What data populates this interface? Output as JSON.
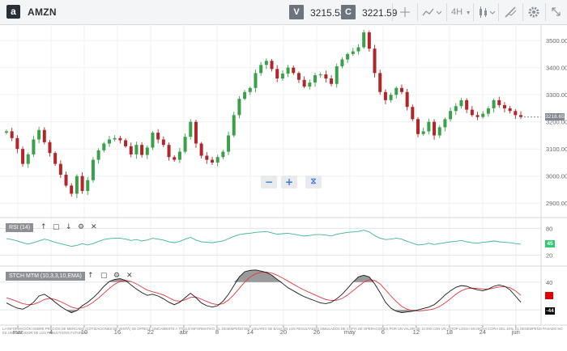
{
  "header": {
    "ticker": "AMZN",
    "logo_letter": "a",
    "sell_label": "V",
    "sell_price": "3215.53",
    "buy_label": "C",
    "buy_price": "3221.59",
    "interval": "4H"
  },
  "icons": [
    "amazon-logo-icon",
    "crosshair-icon",
    "line-chart-icon",
    "candlestick-icon",
    "indicators-icon",
    "settings-icon",
    "fullscreen-icon",
    "zoom-out-icon",
    "zoom-in-icon",
    "share-icon",
    "arrow-up-icon",
    "expand-icon",
    "arrow-down-icon",
    "gear-icon",
    "close-icon"
  ],
  "colors": {
    "bull": "#3aa14a",
    "bear": "#b0262a",
    "rsi": "#3fb68b",
    "stoch_k": "#1a1a1a",
    "stoch_d": "#e0393e",
    "price_tag": "#7f8790",
    "rsi_tag": "#2ecc71",
    "stoch_tag_red": "#e00000",
    "stoch_tag_black": "#000000"
  },
  "price_axis": {
    "ticks": [
      "3500.00",
      "3400.00",
      "3300.00",
      "3200.00",
      "3100.00",
      "3000.00",
      "2900.00"
    ],
    "current_label": "3218.65"
  },
  "x_axis": {
    "labels": [
      "mar",
      "4",
      "10",
      "16",
      "22",
      "abr",
      "8",
      "14",
      "20",
      "26",
      "may",
      "6",
      "12",
      "18",
      "24",
      "jun"
    ]
  },
  "rsi_panel": {
    "label": "RSI (14)",
    "ticks": [
      "80",
      "20"
    ],
    "current_label": "45"
  },
  "stoch_panel": {
    "label": "STCH MTM (10,3,3,10,EMA)",
    "ticks": [
      "40",
      "-40"
    ],
    "tag_red": "",
    "tag_black": "-44"
  },
  "disclaimer": "LA INFORMACIÓN SOBRE PRECIOS DE MERCADO (COTIZACIONES DE VENTA) SE OFRECE ÚNICAMENTE A TÍTULO INFORMATIVO. EL DESEMPEÑO DEL USUARIO SE BASA EN LOS RESULTADOS SIMULADOS DE COPIA DE OPERACIONES POR UN VALOR DE 10,000 CON UN «STOP LOSS» EN DICHA COPIA DEL 40%. EL DESEMPEÑO PASADO NO ES UN INDICADOR DE LOS RESULTADOS FUTUROS.",
  "chart_data": {
    "type": "candlestick",
    "price_axis_range": [
      2850,
      3560
    ],
    "candles": [
      [
        3160,
        3165
      ],
      [
        3165,
        3140
      ],
      [
        3140,
        3100
      ],
      [
        3100,
        3045
      ],
      [
        3045,
        3080
      ],
      [
        3080,
        3135
      ],
      [
        3135,
        3170
      ],
      [
        3170,
        3125
      ],
      [
        3125,
        3085
      ],
      [
        3085,
        3045
      ],
      [
        3045,
        3005
      ],
      [
        3005,
        2965
      ],
      [
        2965,
        2935
      ],
      [
        2935,
        3000
      ],
      [
        3000,
        2945
      ],
      [
        2945,
        2985
      ],
      [
        2985,
        3060
      ],
      [
        3060,
        3095
      ],
      [
        3095,
        3120
      ],
      [
        3120,
        3135
      ],
      [
        3135,
        3140
      ],
      [
        3140,
        3132
      ],
      [
        3132,
        3110
      ],
      [
        3110,
        3080
      ],
      [
        3080,
        3115
      ],
      [
        3115,
        3078
      ],
      [
        3078,
        3105
      ],
      [
        3105,
        3160
      ],
      [
        3160,
        3135
      ],
      [
        3135,
        3115
      ],
      [
        3115,
        3070
      ],
      [
        3070,
        3060
      ],
      [
        3060,
        3090
      ],
      [
        3090,
        3145
      ],
      [
        3145,
        3200
      ],
      [
        3200,
        3120
      ],
      [
        3120,
        3075
      ],
      [
        3075,
        3060
      ],
      [
        3060,
        3050
      ],
      [
        3050,
        3070
      ],
      [
        3070,
        3090
      ],
      [
        3090,
        3150
      ],
      [
        3150,
        3225
      ],
      [
        3225,
        3285
      ],
      [
        3285,
        3310
      ],
      [
        3310,
        3325
      ],
      [
        3325,
        3380
      ],
      [
        3380,
        3410
      ],
      [
        3410,
        3425
      ],
      [
        3425,
        3395
      ],
      [
        3395,
        3360
      ],
      [
        3360,
        3378
      ],
      [
        3378,
        3400
      ],
      [
        3400,
        3380
      ],
      [
        3380,
        3355
      ],
      [
        3355,
        3330
      ],
      [
        3330,
        3345
      ],
      [
        3345,
        3372
      ],
      [
        3372,
        3375
      ],
      [
        3375,
        3360
      ],
      [
        3360,
        3340
      ],
      [
        3340,
        3405
      ],
      [
        3405,
        3430
      ],
      [
        3430,
        3450
      ],
      [
        3450,
        3460
      ],
      [
        3460,
        3475
      ],
      [
        3475,
        3530
      ],
      [
        3530,
        3470
      ],
      [
        3470,
        3380
      ],
      [
        3380,
        3310
      ],
      [
        3310,
        3280
      ],
      [
        3280,
        3300
      ],
      [
        3300,
        3325
      ],
      [
        3325,
        3310
      ],
      [
        3310,
        3255
      ],
      [
        3255,
        3210
      ],
      [
        3210,
        3155
      ],
      [
        3155,
        3165
      ],
      [
        3165,
        3200
      ],
      [
        3200,
        3150
      ],
      [
        3150,
        3180
      ],
      [
        3180,
        3210
      ],
      [
        3210,
        3240
      ],
      [
        3240,
        3258
      ],
      [
        3258,
        3280
      ],
      [
        3280,
        3245
      ],
      [
        3245,
        3225
      ],
      [
        3225,
        3218
      ],
      [
        3218,
        3230
      ],
      [
        3230,
        3250
      ],
      [
        3250,
        3280
      ],
      [
        3280,
        3262
      ],
      [
        3262,
        3250
      ],
      [
        3250,
        3240
      ],
      [
        3240,
        3225
      ],
      [
        3225,
        3218
      ]
    ],
    "rsi": [
      57,
      55,
      52,
      48,
      45,
      48,
      52,
      56,
      53,
      49,
      46,
      43,
      40,
      42,
      46,
      43,
      46,
      51,
      55,
      57,
      58,
      58,
      56,
      53,
      55,
      52,
      54,
      58,
      56,
      54,
      50,
      48,
      51,
      56,
      60,
      54,
      50,
      49,
      48,
      50,
      52,
      57,
      62,
      66,
      68,
      69,
      71,
      72,
      73,
      70,
      67,
      68,
      69,
      67,
      65,
      63,
      64,
      66,
      66,
      65,
      63,
      67,
      69,
      71,
      72,
      73,
      76,
      72,
      64,
      58,
      55,
      56,
      58,
      56,
      51,
      47,
      43,
      44,
      47,
      44,
      46,
      48,
      50,
      51,
      53,
      50,
      48,
      47,
      49,
      50,
      52,
      50,
      49,
      48,
      46,
      45
    ],
    "stoch_k": [
      -20,
      -28,
      -35,
      -38,
      -30,
      -18,
      0,
      5,
      -5,
      -18,
      -30,
      -40,
      -48,
      -42,
      -28,
      -18,
      -5,
      10,
      28,
      42,
      48,
      50,
      45,
      32,
      20,
      10,
      2,
      5,
      0,
      -8,
      -18,
      -25,
      -18,
      -5,
      8,
      -5,
      -20,
      -28,
      -32,
      -28,
      -15,
      5,
      30,
      55,
      70,
      74,
      75,
      72,
      68,
      60,
      48,
      36,
      24,
      15,
      6,
      -2,
      -8,
      -14,
      -20,
      -22,
      -18,
      -8,
      5,
      22,
      40,
      55,
      60,
      55,
      35,
      10,
      -18,
      -35,
      -44,
      -48,
      -46,
      -44,
      -40,
      -36,
      -32,
      -25,
      -12,
      3,
      15,
      25,
      30,
      28,
      22,
      18,
      15,
      20,
      28,
      32,
      28,
      18,
      0,
      -18
    ],
    "stoch_d": [
      -5,
      -10,
      -16,
      -22,
      -25,
      -24,
      -18,
      -10,
      -7,
      -10,
      -16,
      -24,
      -32,
      -36,
      -34,
      -28,
      -18,
      -6,
      8,
      22,
      34,
      42,
      45,
      42,
      35,
      26,
      17,
      12,
      8,
      3,
      -5,
      -13,
      -15,
      -11,
      -4,
      -3,
      -9,
      -16,
      -22,
      -25,
      -22,
      -12,
      4,
      22,
      40,
      55,
      64,
      68,
      69,
      66,
      60,
      52,
      43,
      34,
      25,
      17,
      10,
      3,
      -4,
      -10,
      -13,
      -12,
      -7,
      3,
      15,
      28,
      40,
      47,
      45,
      35,
      18,
      0,
      -16,
      -30,
      -38,
      -42,
      -43,
      -42,
      -40,
      -37,
      -30,
      -20,
      -8,
      5,
      15,
      21,
      23,
      22,
      20,
      20,
      23,
      26,
      27,
      24,
      15,
      2
    ],
    "stoch_k_last": -44
  }
}
